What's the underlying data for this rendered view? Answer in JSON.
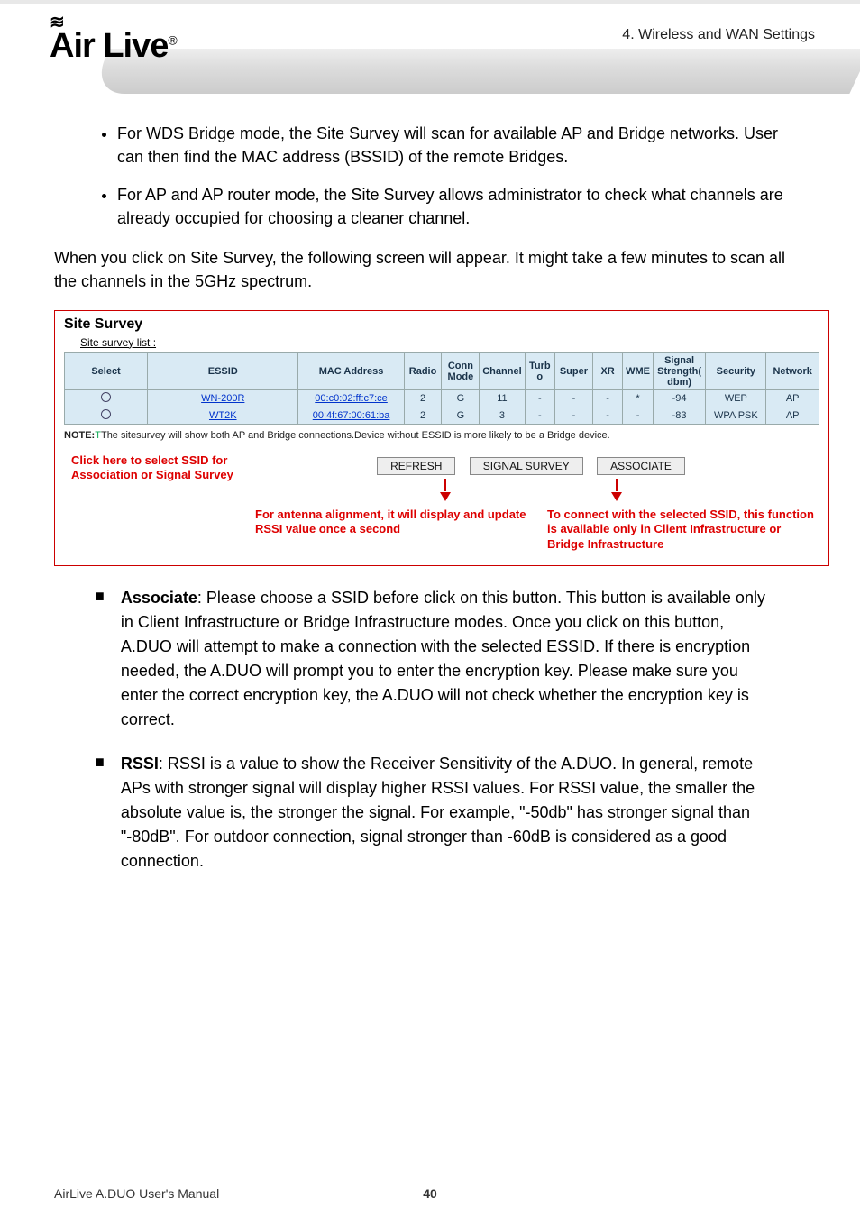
{
  "header": {
    "brand": "Air Live",
    "reg": "®",
    "section": "4. Wireless and WAN Settings"
  },
  "intro": {
    "b1": "For WDS Bridge mode, the Site Survey will scan for available AP and Bridge networks. User can then find the MAC address (BSSID) of the remote Bridges.",
    "b2": "For AP and AP router mode, the Site Survey allows administrator to check what channels are already occupied for choosing a cleaner channel.",
    "p1": "When you click on Site Survey, the following screen will appear. It might take a few minutes to scan all the channels in the 5GHz spectrum."
  },
  "survey": {
    "title": "Site Survey",
    "sub": "Site survey list :",
    "cols": {
      "select": "Select",
      "essid": "ESSID",
      "mac": "MAC Address",
      "radio": "Radio",
      "conn": "ConnMode",
      "chan": "Channel",
      "turbo": "Turbo",
      "super": "Super",
      "xr": "XR",
      "wme": "WME",
      "sig": "Signal Strength(dbm)",
      "sec": "Security",
      "net": "Network"
    },
    "rows": [
      {
        "essid": "WN-200R",
        "mac": "00:c0:02:ff:c7:ce",
        "radio": "2",
        "conn": "G",
        "chan": "11",
        "turbo": "-",
        "super": "-",
        "xr": "-",
        "wme": "*",
        "sig": "-94",
        "sec": "WEP",
        "net": "AP"
      },
      {
        "essid": "WT2K",
        "mac": "00:4f:67:00:61:ba",
        "radio": "2",
        "conn": "G",
        "chan": "3",
        "turbo": "-",
        "super": "-",
        "xr": "-",
        "wme": "-",
        "sig": "-83",
        "sec": "WPA PSK",
        "net": "AP"
      }
    ],
    "note_prefix": "NOTE:",
    "note_body": "The sitesurvey will show both AP and Bridge connections.Device without ESSID is more likely to be a Bridge device.",
    "buttons": {
      "refresh": "REFRESH",
      "signal": "SIGNAL SURVEY",
      "associate": "ASSOCIATE"
    },
    "callouts": {
      "left": "Click here to select SSID for Association or Signal Survey",
      "middle": "For antenna alignment, it will display and update RSSI value once a second",
      "right": "To connect with the selected SSID, this function is available only in Client Infrastructure or Bridge Infrastructure"
    }
  },
  "paras": {
    "assoc_title": "Associate",
    "assoc_body": ": Please choose a SSID before click on this button. This button is available only in Client Infrastructure or Bridge Infrastructure modes. Once you click on this button, A.DUO will attempt to make a connection with the selected ESSID. If there is encryption needed, the A.DUO will prompt you to enter the encryption key. Please make sure you enter the correct encryption key, the A.DUO will not check whether the encryption key is correct.",
    "rssi_title": "RSSI",
    "rssi_body": ": RSSI is a value to show the Receiver Sensitivity of the A.DUO. In general, remote APs with stronger signal will display higher RSSI values. For RSSI value, the smaller the absolute value is, the stronger the signal. For example, \"-50db\" has stronger signal than \"-80dB\". For outdoor connection, signal stronger than -60dB is considered as a good connection."
  },
  "footer": {
    "left": "AirLive A.DUO User's Manual",
    "page": "40"
  }
}
